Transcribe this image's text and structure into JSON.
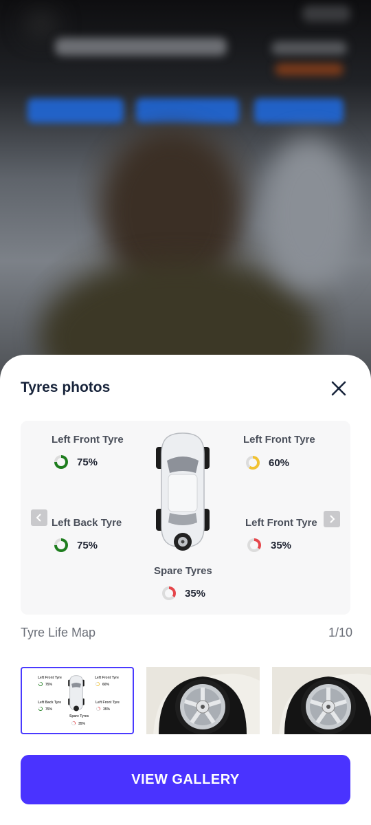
{
  "sheet": {
    "title": "Tyres photos",
    "close_icon": "close-icon"
  },
  "tyre_map": {
    "tyres": [
      {
        "label": "Left Front Tyre",
        "percent": "75%",
        "color": "#1e7d1e",
        "fill": 0.75
      },
      {
        "label": "Left Front Tyre",
        "percent": "60%",
        "color": "#f1c232",
        "fill": 0.6
      },
      {
        "label": "Left Back Tyre",
        "percent": "75%",
        "color": "#1e7d1e",
        "fill": 0.75
      },
      {
        "label": "Left Front Tyre",
        "percent": "35%",
        "color": "#e5464b",
        "fill": 0.35
      },
      {
        "label": "Spare Tyres",
        "percent": "35%",
        "color": "#e5464b",
        "fill": 0.35
      }
    ],
    "prev_icon": "chevron-left-icon",
    "next_icon": "chevron-right-icon"
  },
  "footer": {
    "label": "Tyre Life Map",
    "counter": "1/10"
  },
  "button": {
    "label": "VIEW GALLERY"
  },
  "colors": {
    "accent": "#4a33ff",
    "title": "#17233a",
    "track": "#dcdcdc"
  }
}
